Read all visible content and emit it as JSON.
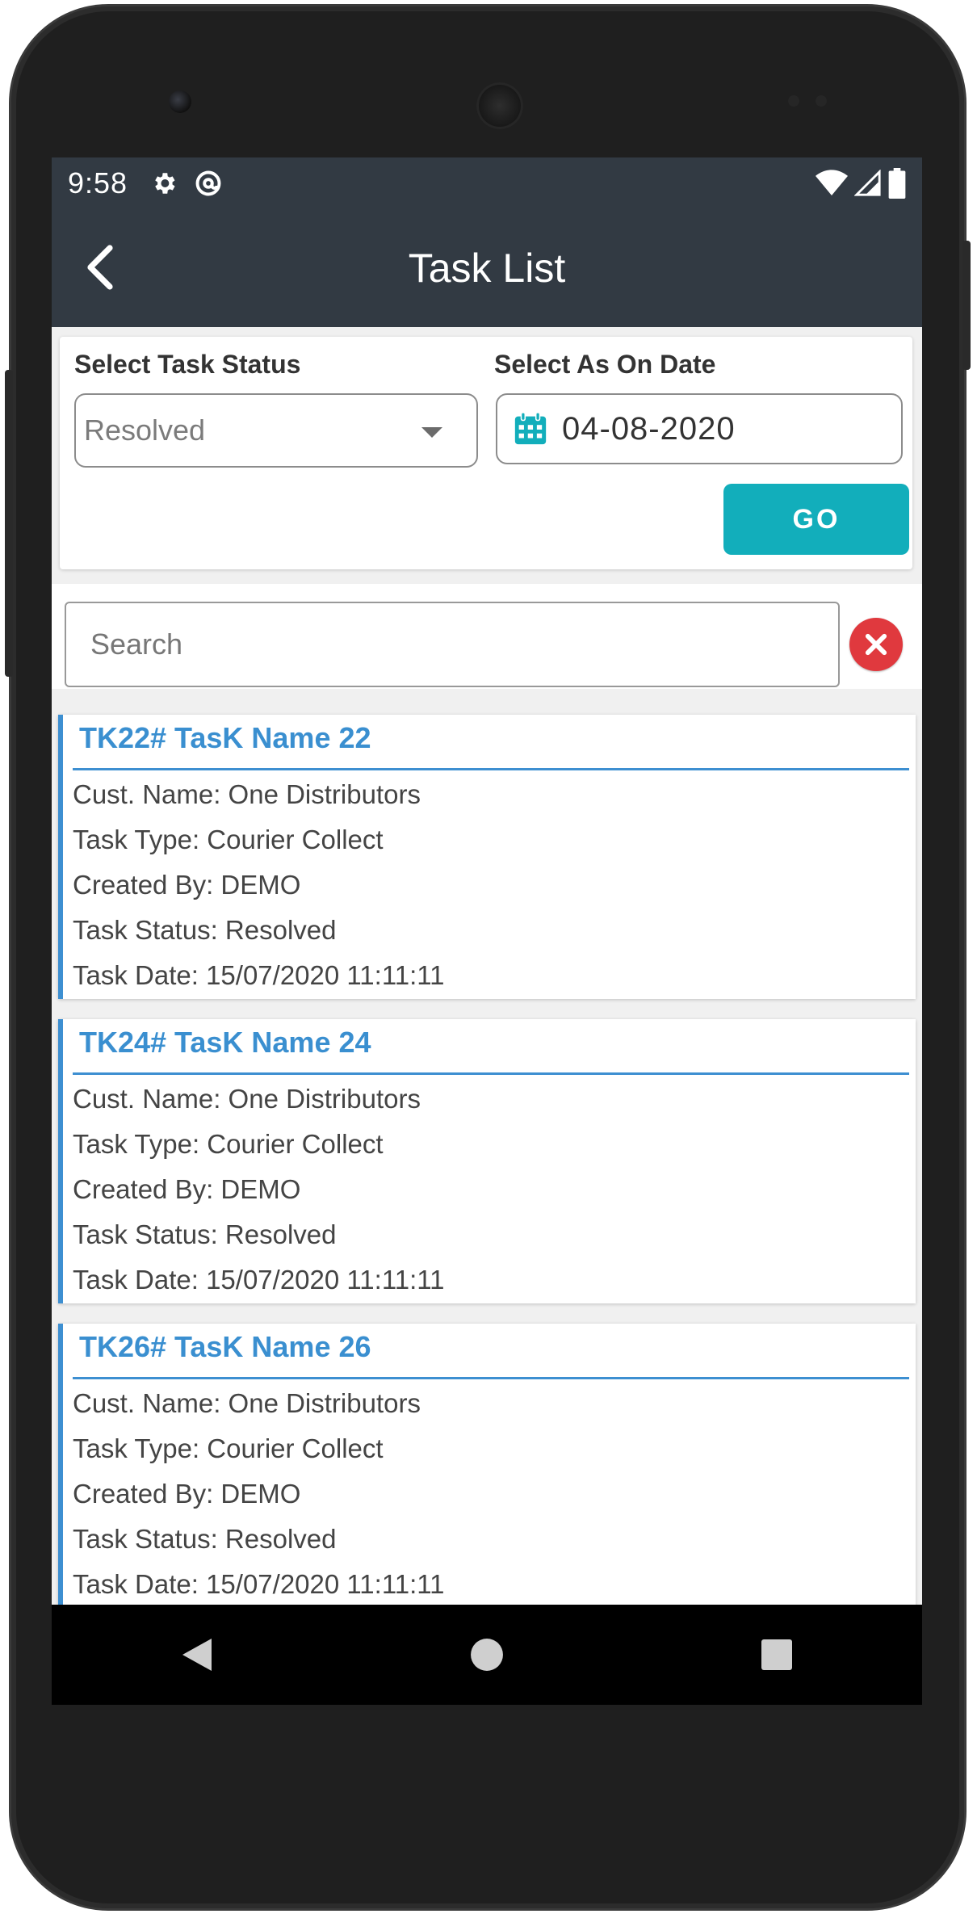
{
  "status_bar": {
    "time": "9:58",
    "icons": [
      "gear-icon",
      "at-sign-icon",
      "wifi-icon",
      "signal-icon",
      "battery-icon"
    ]
  },
  "app_bar": {
    "title": "Task List",
    "back_icon": "chevron-left-icon"
  },
  "filters": {
    "status_label": "Select Task Status",
    "status_value": "Resolved",
    "date_label": "Select As On Date",
    "date_value": "04-08-2020",
    "go_label": "GO"
  },
  "search": {
    "placeholder": "Search"
  },
  "tasks": [
    {
      "title": "TK22# TasK Name 22",
      "customer": "Cust. Name: One Distributors",
      "type": "Task Type: Courier Collect",
      "created_by": "Created By: DEMO",
      "status": "Task Status: Resolved",
      "date": "Task Date: 15/07/2020 11:11:11"
    },
    {
      "title": "TK24# TasK Name 24",
      "customer": "Cust. Name: One Distributors",
      "type": "Task Type: Courier Collect",
      "created_by": "Created By: DEMO",
      "status": "Task Status: Resolved",
      "date": "Task Date: 15/07/2020 11:11:11"
    },
    {
      "title": "TK26# TasK Name 26",
      "customer": "Cust. Name: One Distributors",
      "type": "Task Type: Courier Collect",
      "created_by": "Created By: DEMO",
      "status": "Task Status: Resolved",
      "date": "Task Date: 15/07/2020 11:11:11"
    }
  ],
  "colors": {
    "app_bar": "#323a43",
    "accent_teal": "#12aebb",
    "task_blue": "#3a8fd0",
    "clear_red": "#e0393e"
  }
}
